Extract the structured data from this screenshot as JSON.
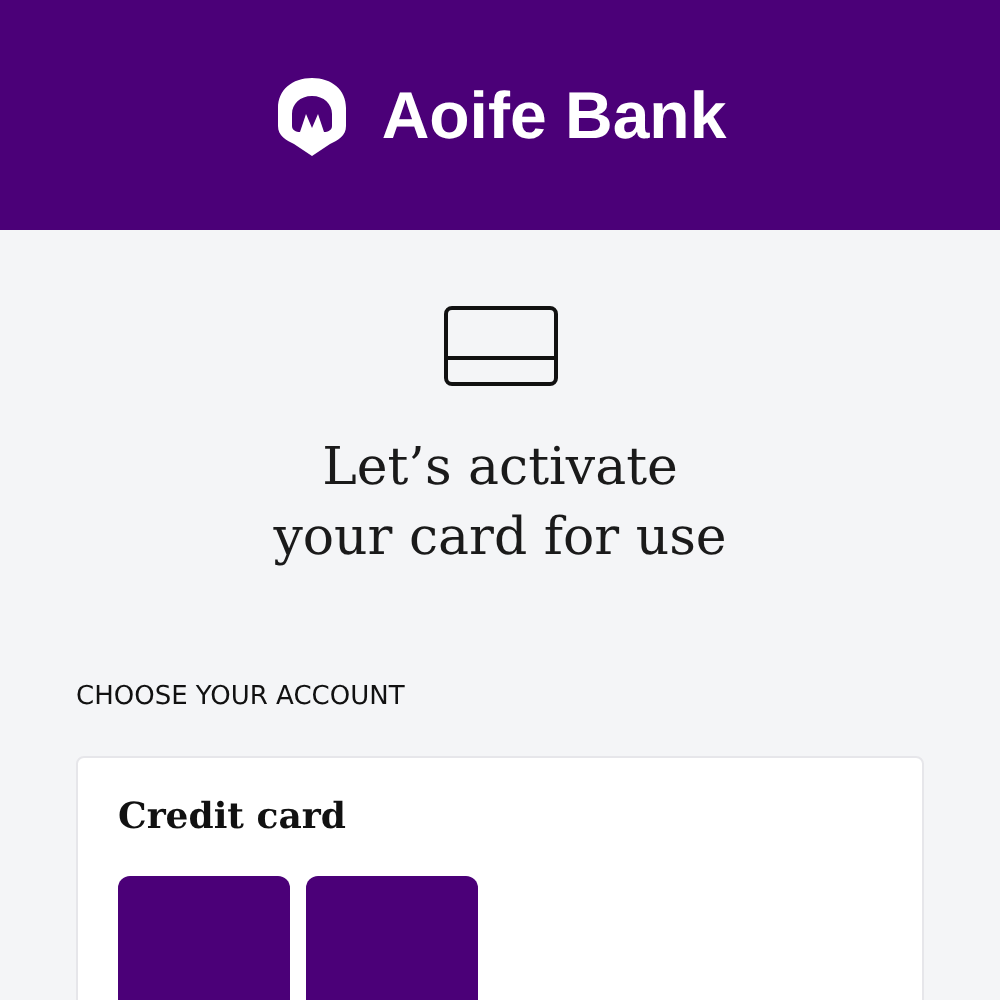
{
  "header": {
    "brand": "Aoife Bank"
  },
  "intro": {
    "title_lines": [
      "Let’s activate",
      "your card for use"
    ]
  },
  "section": {
    "label": "CHOOSE YOUR ACCOUNT"
  },
  "account_group": {
    "title": "Credit card",
    "cards": [
      {
        "kind": "card"
      },
      {
        "kind": "card"
      }
    ]
  }
}
